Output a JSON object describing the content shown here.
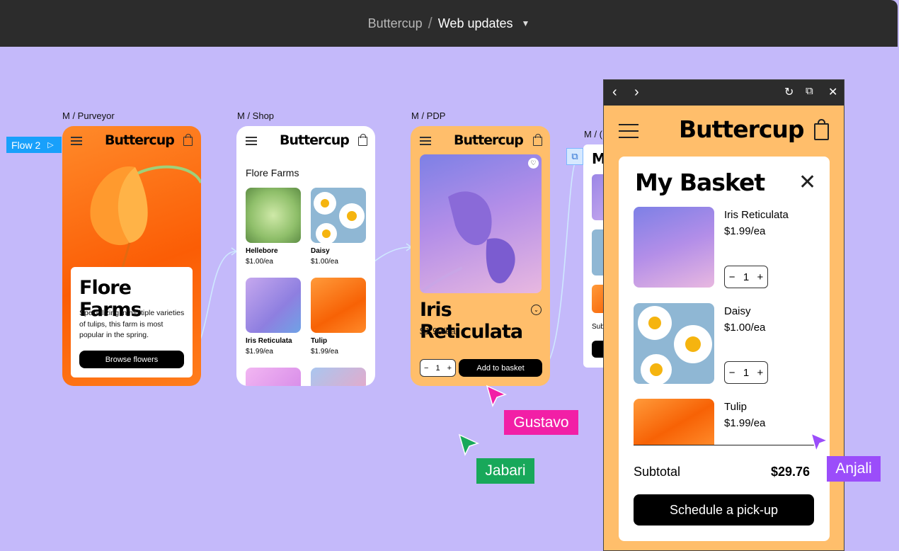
{
  "topbar": {
    "project": "Buttercup",
    "separator": "/",
    "file": "Web updates",
    "chevron": "⌄"
  },
  "flow": {
    "label": "Flow 2",
    "icon": "play-icon"
  },
  "frames": {
    "purveyor": {
      "label": "M / Purveyor",
      "brand": "Buttercup",
      "title": "Flore Farms",
      "desc": "Specializing in multiple varieties of tulips, this farm is most popular in the spring.",
      "button": "Browse flowers"
    },
    "shop": {
      "label": "M / Shop",
      "brand": "Buttercup",
      "heading": "Flore Farms",
      "items": [
        {
          "name": "Hellebore",
          "price": "$1.00/ea"
        },
        {
          "name": "Daisy",
          "price": "$1.00/ea"
        },
        {
          "name": "Iris Reticulata",
          "price": "$1.99/ea"
        },
        {
          "name": "Tulip",
          "price": "$1.99/ea"
        }
      ]
    },
    "pdp": {
      "label": "M / PDP",
      "brand": "Buttercup",
      "title": "Iris Reticulata",
      "price": "$1.99/ea",
      "qty": "1",
      "button": "Add to basket"
    },
    "partial": {
      "label": "M / (",
      "brand_letter": "M",
      "text": "Sub"
    }
  },
  "preview": {
    "nav_back": "‹",
    "nav_forward": "›",
    "brand": "Buttercup",
    "basket_title": "My Basket",
    "items": [
      {
        "name": "Iris Reticulata",
        "price": "$1.99/ea",
        "qty": "1"
      },
      {
        "name": "Daisy",
        "price": "$1.00/ea",
        "qty": "1"
      },
      {
        "name": "Tulip",
        "price": "$1.99/ea"
      }
    ],
    "subtotal_label": "Subtotal",
    "subtotal_value": "$29.76",
    "cta": "Schedule a pick-up"
  },
  "cursors": [
    {
      "name": "Gustavo",
      "color": "#f21fa6"
    },
    {
      "name": "Jabari",
      "color": "#18a85a"
    },
    {
      "name": "Anjali",
      "color": "#9b4dfa"
    }
  ],
  "colors": {
    "canvas": "#c4b9fa",
    "orange": "#ffbe6b",
    "tulip": "#fa6a0a",
    "flow": "#18a0fb"
  }
}
